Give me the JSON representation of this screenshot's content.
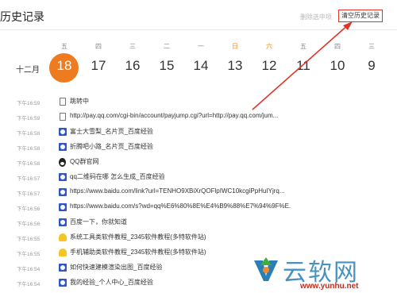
{
  "header": {
    "title": "历史记录",
    "delete_label": "删除选中项",
    "clear_label": "清空历史记录"
  },
  "calendar": {
    "month": "十二月",
    "days": [
      {
        "weekday": "五",
        "day": "18",
        "selected": true
      },
      {
        "weekday": "四",
        "day": "17"
      },
      {
        "weekday": "三",
        "day": "16"
      },
      {
        "weekday": "二",
        "day": "15"
      },
      {
        "weekday": "一",
        "day": "14"
      },
      {
        "weekday": "日",
        "day": "13",
        "weekend": true
      },
      {
        "weekday": "六",
        "day": "12",
        "weekend": true
      },
      {
        "weekday": "五",
        "day": "11"
      },
      {
        "weekday": "四",
        "day": "10"
      },
      {
        "weekday": "三",
        "day": "9"
      }
    ]
  },
  "history": [
    {
      "time": "下午16:59",
      "icon": "document-icon",
      "text": "跳转中"
    },
    {
      "time": "下午16:59",
      "icon": "document-icon",
      "text": "http://pay.qq.com/cgi-bin/account/payjump.cgi?url=http://pay.qq.com/jum..."
    },
    {
      "time": "下午16:58",
      "icon": "baidu-icon",
      "text": "富士大雪梨_名片页_百度经验"
    },
    {
      "time": "下午16:58",
      "icon": "baidu-icon",
      "text": "折腾吧小路_名片页_百度经验"
    },
    {
      "time": "下午16:58",
      "icon": "qq-icon",
      "text": "QQ群官网"
    },
    {
      "time": "下午16:57",
      "icon": "baidu-icon",
      "text": "qq二维码在哪 怎么生成_百度经验"
    },
    {
      "time": "下午16:57",
      "icon": "baidu-icon",
      "text": "https://www.baidu.com/link?url=TENHO9XBiXrQOFlpIWC10kcgiPpHuIYjrq..."
    },
    {
      "time": "下午16:56",
      "icon": "baidu-icon",
      "text": "https://www.baidu.com/s?wd=qq%E6%80%8E%E4%B9%88%E7%94%9F%E..."
    },
    {
      "time": "下午16:56",
      "icon": "baidu-icon",
      "text": "百度一下，你就知道"
    },
    {
      "time": "下午16:55",
      "icon": "2345-icon",
      "text": "系统工具类软件教程_2345软件教程(多特软件站)"
    },
    {
      "time": "下午16:55",
      "icon": "2345-icon",
      "text": "手机辅助类软件教程_2345软件教程(多特软件站)"
    },
    {
      "time": "下午16:54",
      "icon": "baidu-icon",
      "text": "如何快速建模渲染出图_百度经验"
    },
    {
      "time": "下午16:54",
      "icon": "baidu-icon",
      "text": "我的经验_个人中心_百度经验"
    }
  ],
  "watermark": {
    "text": "云软网",
    "url": "www.yunhu.net"
  },
  "colors": {
    "accent": "#ee7b1f",
    "annotation": "#e0342b"
  }
}
